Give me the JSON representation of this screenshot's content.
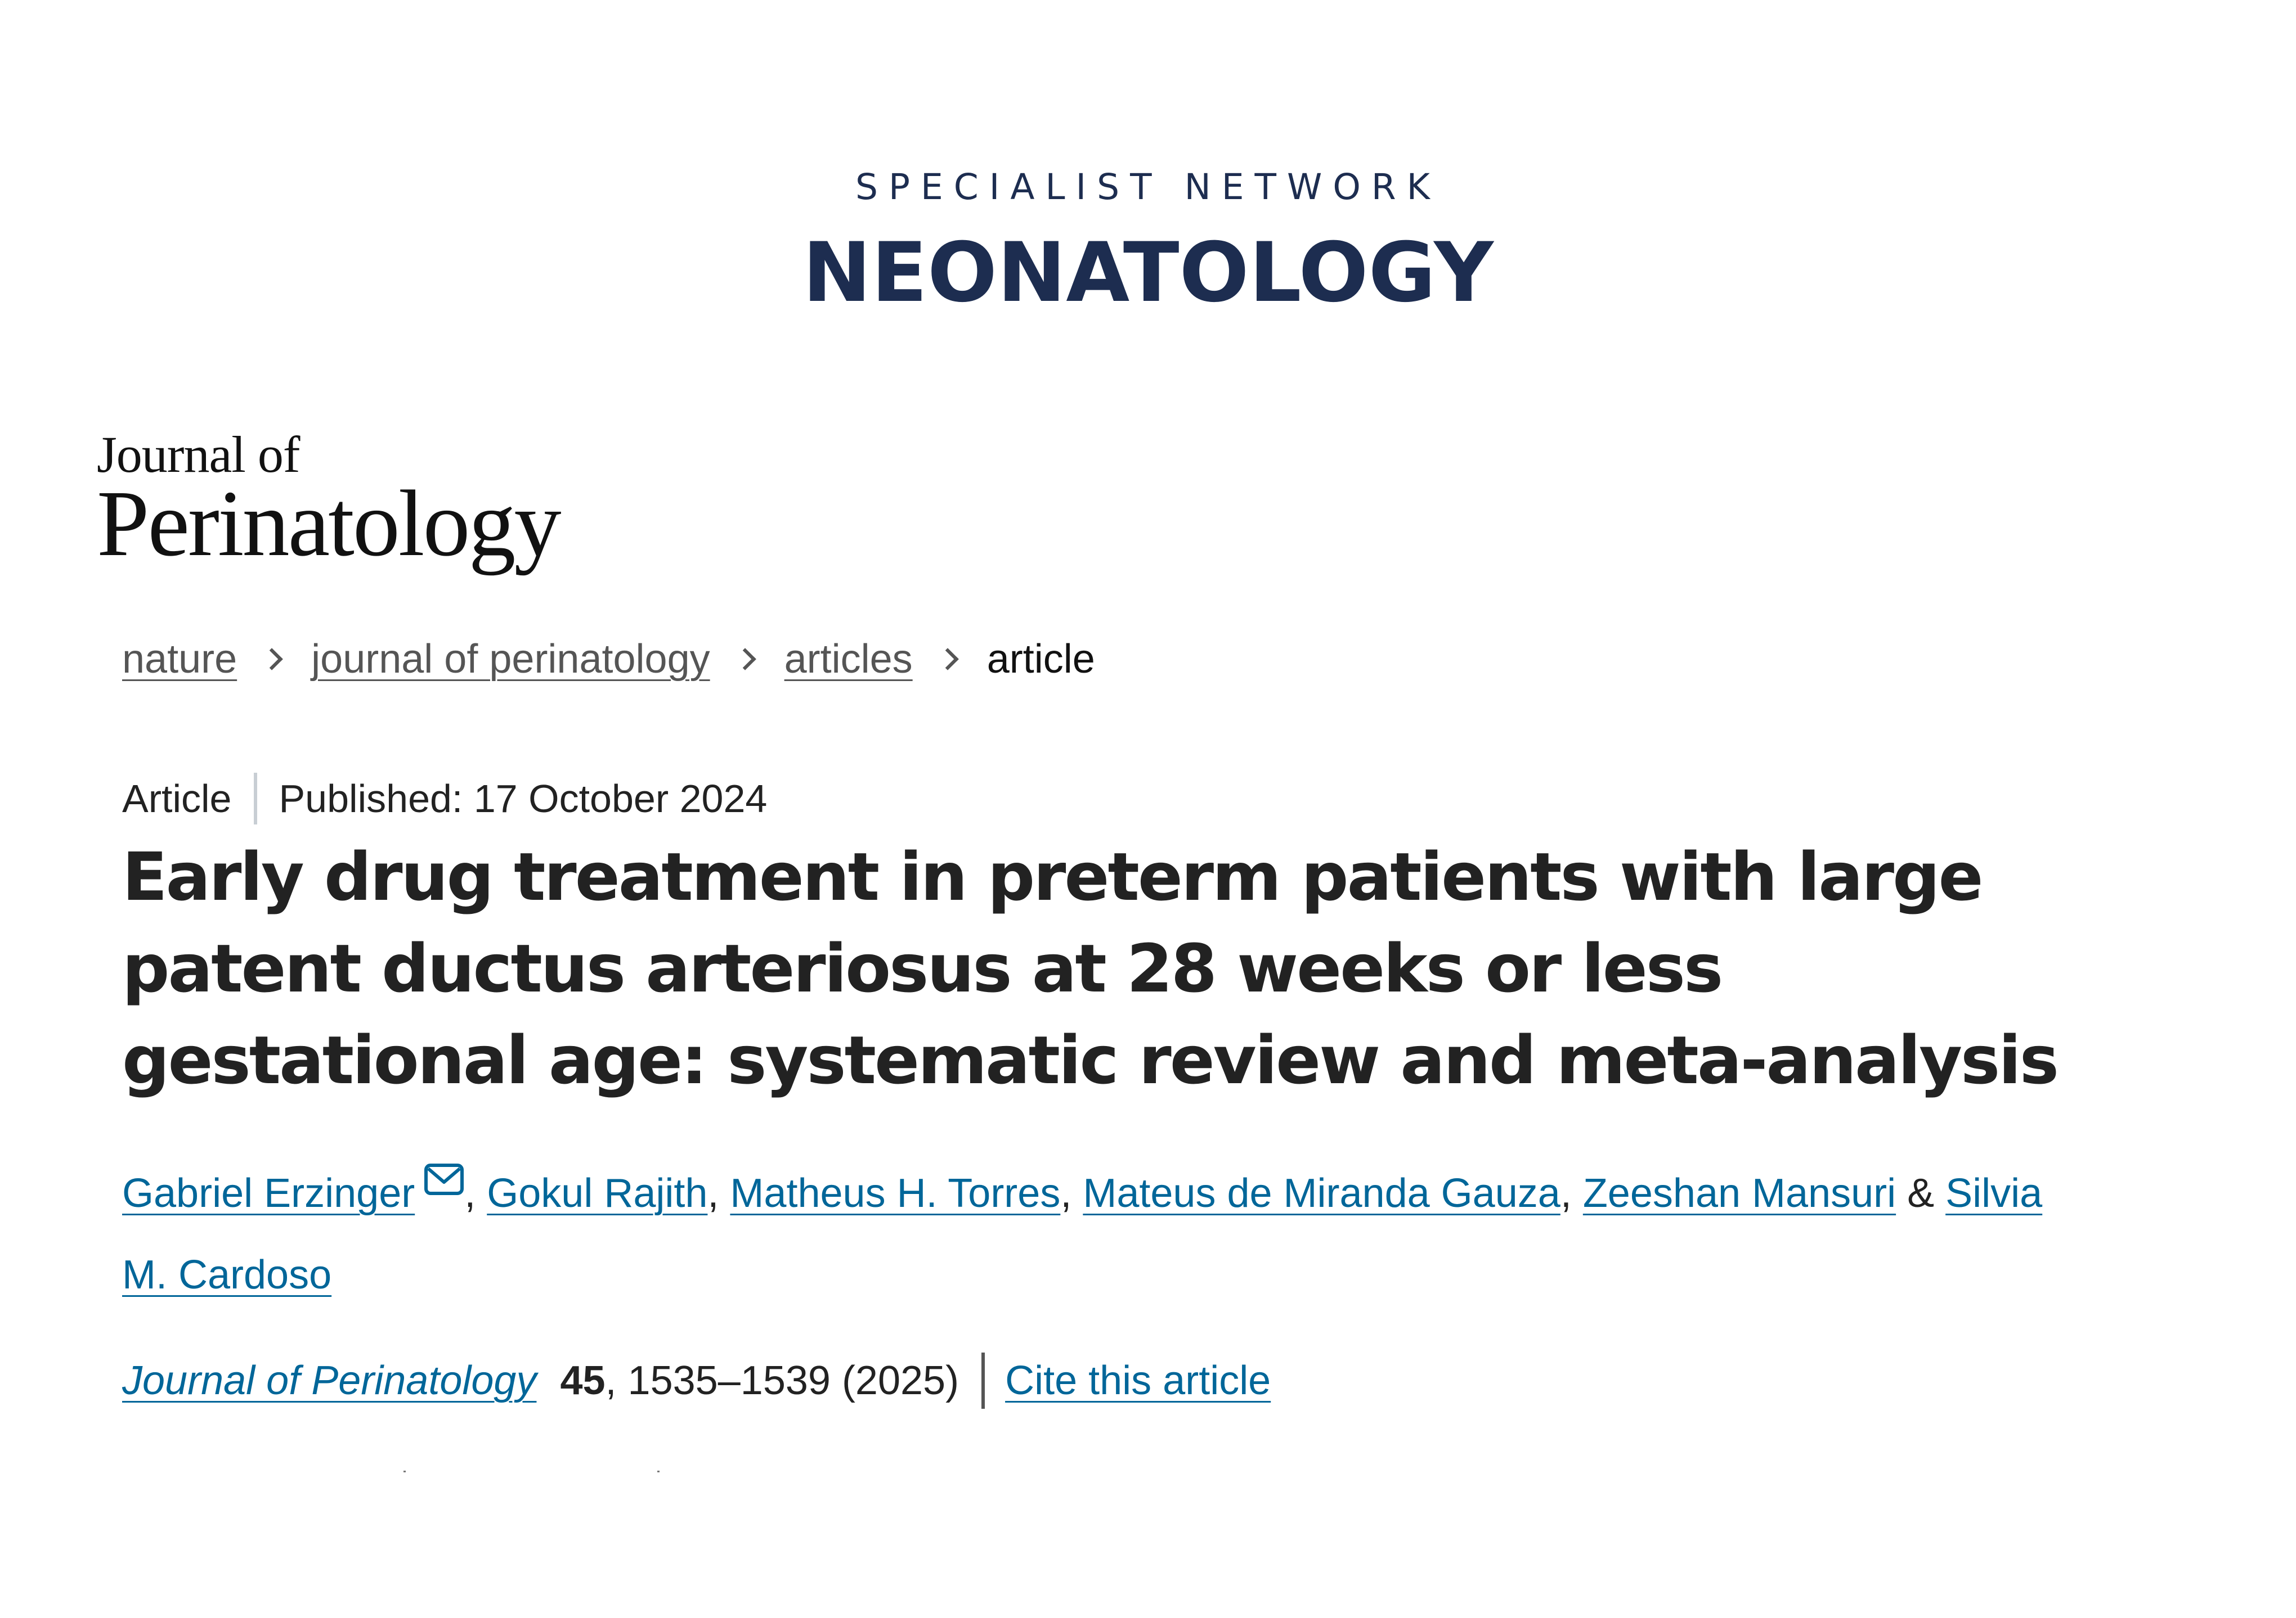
{
  "banner": {
    "kicker": "SPECIALIST NETWORK",
    "title": "NEONATOLOGY"
  },
  "journal_logo": {
    "line1": "Journal of",
    "line2": "Perinatology"
  },
  "breadcrumb": {
    "items": [
      "nature",
      "journal of perinatology",
      "articles",
      "article"
    ]
  },
  "article": {
    "type": "Article",
    "published": "Published: 17 October 2024",
    "title": "Early drug treatment in preterm patients with large patent ductus arteriosus at 28 weeks or less gestational age: systematic review and meta-analysis"
  },
  "authors": {
    "names": [
      "Gabriel Erzinger",
      "Gokul Rajith",
      "Matheus H. Torres",
      "Mateus de Miranda Gauza",
      "Zeeshan Mansuri",
      "Silvia M. Cardoso"
    ],
    "separator": ", ",
    "final_separator": " & ",
    "corresponding_icon": "mail-icon"
  },
  "citation": {
    "journal": "Journal of Perinatology",
    "volume": "45",
    "pages_year": ", 1535–1539 (2025)",
    "cite_label": "Cite this article"
  },
  "colors": {
    "banner_navy": "#1d2d50",
    "link_blue": "#006699",
    "text": "#222222"
  }
}
